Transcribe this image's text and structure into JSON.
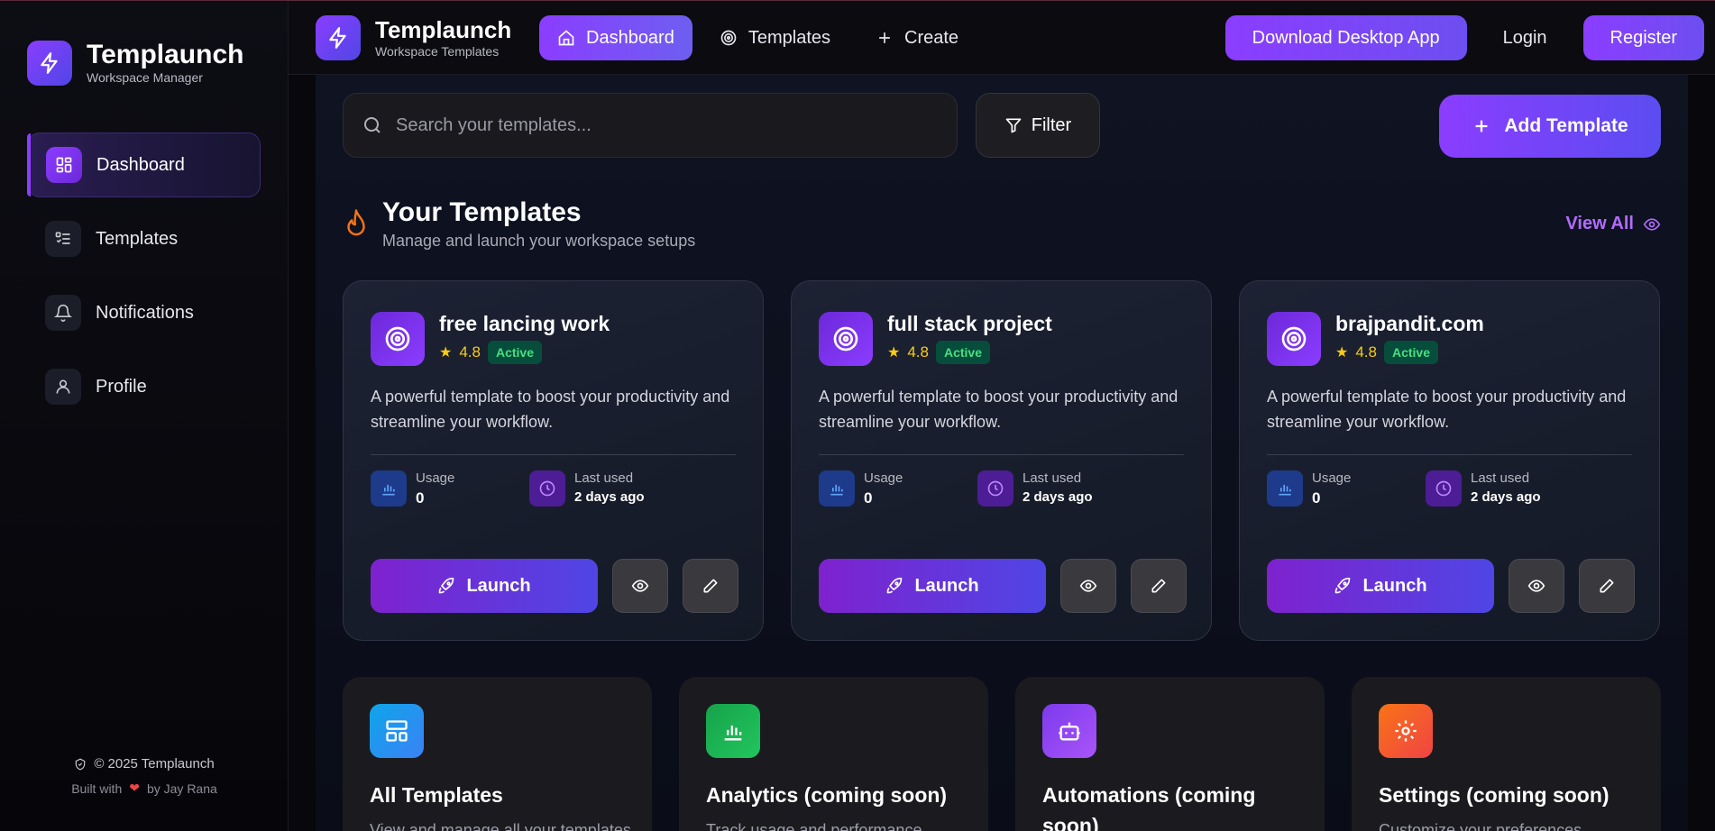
{
  "sidebar": {
    "brand_title": "Templaunch",
    "brand_sub": "Workspace Manager",
    "items": [
      {
        "label": "Dashboard",
        "icon": "dashboard-icon",
        "active": true
      },
      {
        "label": "Templates",
        "icon": "list-icon"
      },
      {
        "label": "Notifications",
        "icon": "bell-icon"
      },
      {
        "label": "Profile",
        "icon": "user-icon"
      }
    ],
    "footer_copyright": "© 2025 Templaunch",
    "footer_built_prefix": "Built with",
    "footer_built_suffix": "by Jay Rana"
  },
  "topbar": {
    "brand_title": "Templaunch",
    "brand_sub": "Workspace Templates",
    "nav": [
      {
        "label": "Dashboard",
        "active": true
      },
      {
        "label": "Templates"
      },
      {
        "label": "Create"
      }
    ],
    "download_label": "Download Desktop App",
    "login_label": "Login",
    "register_label": "Register"
  },
  "main": {
    "search_placeholder": "Search your templates...",
    "filter_label": "Filter",
    "add_label": "Add Template",
    "section_title": "Your Templates",
    "section_sub": "Manage and launch your workspace setups",
    "view_all": "View All",
    "cards": [
      {
        "title": "free lancing work",
        "rating": "4.8",
        "status": "Active",
        "desc": "A powerful template to boost your productivity and streamline your workflow.",
        "usage_label": "Usage",
        "usage": "0",
        "last_label": "Last used",
        "last": "2 days ago",
        "launch": "Launch"
      },
      {
        "title": "full stack project",
        "rating": "4.8",
        "status": "Active",
        "desc": "A powerful template to boost your productivity and streamline your workflow.",
        "usage_label": "Usage",
        "usage": "0",
        "last_label": "Last used",
        "last": "2 days ago",
        "launch": "Launch"
      },
      {
        "title": "brajpandit.com",
        "rating": "4.8",
        "status": "Active",
        "desc": "A powerful template to boost your productivity and streamline your workflow.",
        "usage_label": "Usage",
        "usage": "0",
        "last_label": "Last used",
        "last": "2 days ago",
        "launch": "Launch"
      }
    ],
    "features": [
      {
        "title": "All Templates",
        "desc": "View and manage all your templates",
        "icon": "layout-icon",
        "color": "#1d9bf0"
      },
      {
        "title": "Analytics (coming soon)",
        "desc": "Track usage and performance",
        "icon": "chart-icon",
        "color": "#22c55e"
      },
      {
        "title": "Automations (coming soon)",
        "desc": "",
        "icon": "bot-icon",
        "color": "#8b5cf6"
      },
      {
        "title": "Settings (coming soon)",
        "desc": "Customize your preferences",
        "icon": "gear-icon",
        "color": "#f97316"
      }
    ]
  },
  "colors": {
    "accent": "#8b3dff",
    "accent2": "#4f46e5",
    "link": "#b36bff",
    "star": "#facc15"
  }
}
